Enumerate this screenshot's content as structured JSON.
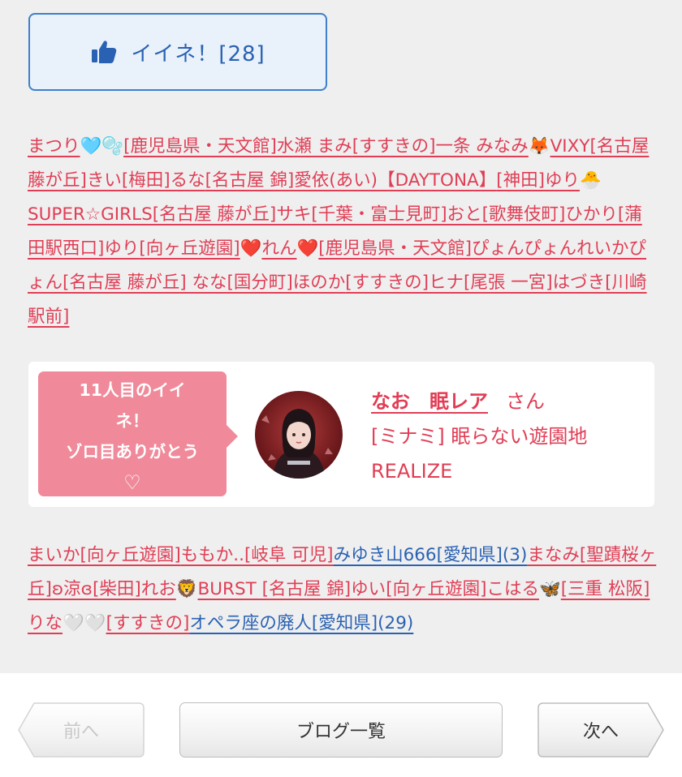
{
  "like_button": {
    "label": "イイネ！[28]"
  },
  "likers_top": {
    "items": [
      {
        "name": "まつり",
        "emoji": "🩵🫧"
      },
      {
        "name": "[鹿児島県・天文館]水瀬 まみ"
      },
      {
        "name": "[すすきの]一条 みなみ",
        "emoji": "🦊"
      },
      {
        "name": "VIXY[名古屋 藤が丘]きい"
      },
      {
        "name": "[梅田]るな"
      },
      {
        "name": "[名古屋 錦]愛依(あい)"
      },
      {
        "name": "【DAYTONA】"
      },
      {
        "name": "[神田]ゆり",
        "emoji": "🐣"
      },
      {
        "name": "SUPER☆GIRLS[名古屋 藤が丘]サキ"
      },
      {
        "name": "[千葉・富士見町]おと"
      },
      {
        "name": "[歌舞伎町]ひかり"
      },
      {
        "name": "[蒲田駅西口]ゆり"
      },
      {
        "name": "[向ヶ丘遊園]",
        "emoji": "❤️"
      },
      {
        "name": "れん",
        "emoji": "❤️"
      },
      {
        "name": "[鹿児島県・天文館]ぴょんぴょんれいかぴょん"
      },
      {
        "name": "[名古屋 藤が丘] なな"
      },
      {
        "name": "[国分町]ほのか"
      },
      {
        "name": "[すすきの]ヒナ"
      },
      {
        "name": "[尾張 一宮]はづき"
      },
      {
        "name": "[川崎駅前]"
      }
    ]
  },
  "milestone_card": {
    "bubble_lines": [
      "11人目のイイ",
      "ネ！",
      "ゾロ目ありがとう",
      "♡"
    ],
    "girl_name": "なお　眠レア",
    "honorific": "さん",
    "shop_line1": "[ミナミ] 眠らない遊園地",
    "shop_line2": "REALIZE",
    "avatar_alt": "avatar"
  },
  "likers_bottom": {
    "items": [
      {
        "name": "まいか[向ヶ丘遊園]"
      },
      {
        "name": "ももか..[岐阜 可児]"
      },
      {
        "name": "みゆき山666[愛知県](3)",
        "color": "#2a62b3"
      },
      {
        "name": "まなみ[聖蹟桜ヶ丘]"
      },
      {
        "name": "ʚ涼ɞ[柴田]"
      },
      {
        "name": "れお",
        "emoji": "🦁"
      },
      {
        "name": "BURST [名古屋 錦]ゆい"
      },
      {
        "name": "[向ヶ丘遊園]こはる",
        "emoji": "🦋"
      },
      {
        "name": "[三重 松阪]りな",
        "emoji": "🤍🤍"
      },
      {
        "name": "[すすきの]"
      },
      {
        "name": "オペラ座の廃人[愛知県](29)",
        "color": "#2a62b3"
      }
    ]
  },
  "nav": {
    "prev": "前へ",
    "list": "ブログ一覧",
    "next": "次へ"
  }
}
